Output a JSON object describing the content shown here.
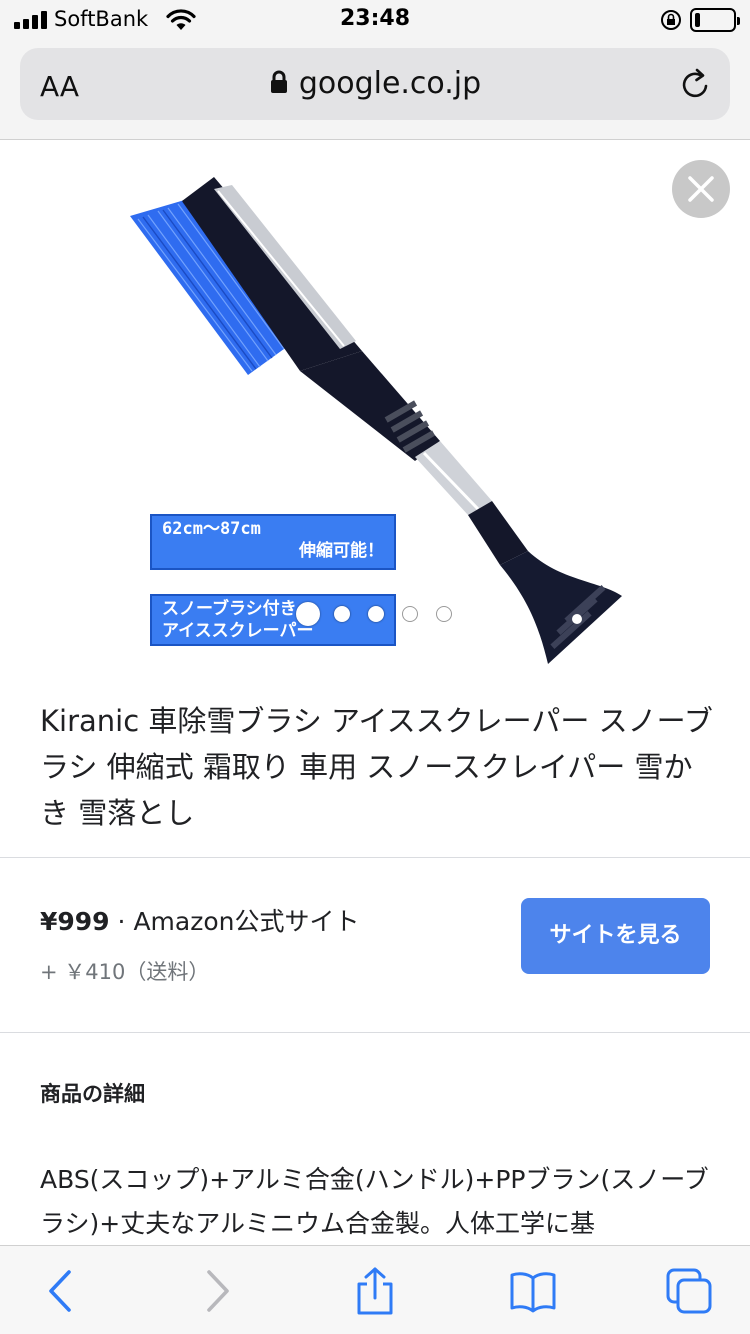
{
  "status_bar": {
    "carrier": "SoftBank",
    "time": "23:48",
    "battery_level": 0.15
  },
  "browser": {
    "aa_label": "AA",
    "url": "google.co.jp"
  },
  "product": {
    "image_labels": {
      "length_line1": "62cm〜87cm",
      "length_line2": "伸縮可能！",
      "type_line1": "スノーブラシ付き",
      "type_line2": "アイススクレーパー"
    },
    "carousel": {
      "total": 5,
      "active_index": 0
    },
    "title": "Kiranic 車除雪ブラシ アイススクレーパー スノーブラシ 伸縮式 霜取り 車用 スノースクレイパー 雪かき 雪落とし"
  },
  "offer": {
    "price": "¥999",
    "separator": " · ",
    "seller": "Amazon公式サイト",
    "shipping": "+ ￥410（送料）",
    "button_label": "サイトを見る"
  },
  "details": {
    "heading": "商品の詳細",
    "text": "ABS(スコップ)+アルミ合金(ハンドル)+PPブラン(スノーブラシ)+丈夫なアルミニウム合金製。人体工学に基"
  },
  "colors": {
    "accent": "#4d84ec",
    "brush_blue": "#2f6cf0",
    "label_blue": "#3a7df2"
  },
  "toolbar": {
    "icons": [
      "back-icon",
      "forward-icon",
      "share-icon",
      "bookmarks-icon",
      "tabs-icon"
    ]
  }
}
